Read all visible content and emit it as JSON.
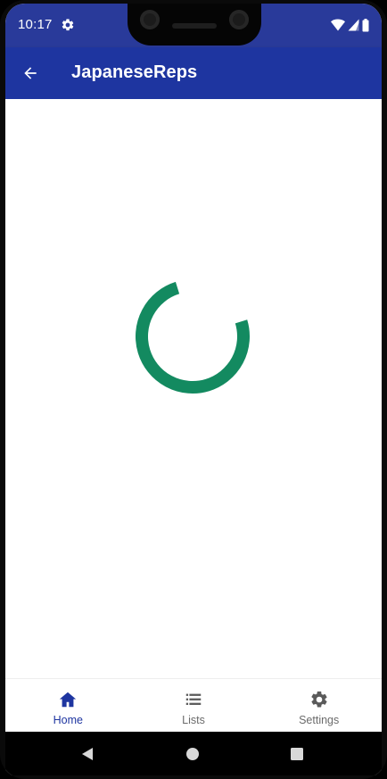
{
  "status_bar": {
    "time": "10:17",
    "settings_icon": "gear-icon",
    "wifi_icon": "wifi-icon",
    "signal_icon": "signal-icon",
    "battery_icon": "battery-icon"
  },
  "app_bar": {
    "back_icon": "arrow-back-icon",
    "title": "JapaneseReps",
    "color": "#1e35a0"
  },
  "content": {
    "loading_indicator": "circular-progress",
    "indicator_color": "#138a60"
  },
  "bottom_nav": {
    "items": [
      {
        "label": "Home",
        "icon": "home-icon",
        "active": true
      },
      {
        "label": "Lists",
        "icon": "list-icon",
        "active": false
      },
      {
        "label": "Settings",
        "icon": "gear-icon",
        "active": false
      }
    ],
    "active_color": "#1e35a0",
    "inactive_color": "#6b6b6b"
  },
  "system_nav": {
    "buttons": [
      "back-triangle-icon",
      "home-circle-icon",
      "recents-square-icon"
    ]
  }
}
